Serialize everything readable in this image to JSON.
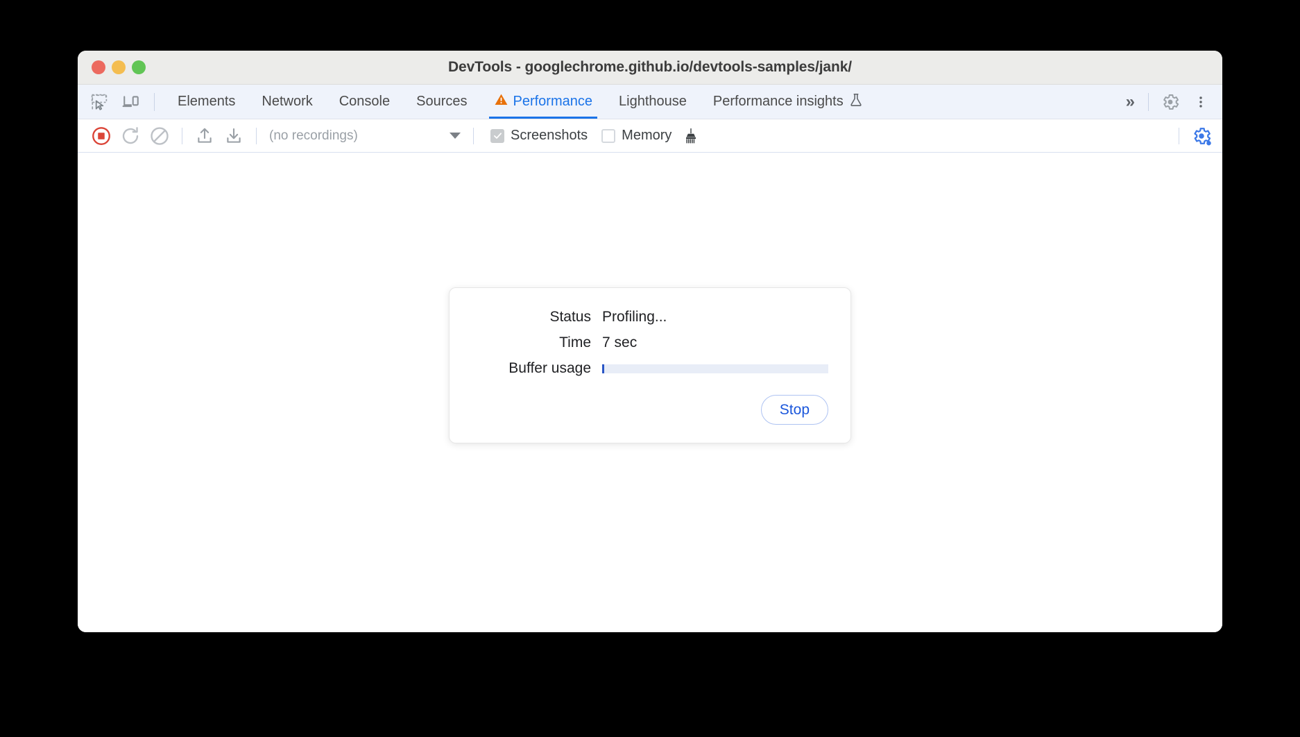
{
  "window": {
    "title": "DevTools - googlechrome.github.io/devtools-samples/jank/",
    "traffic_lights": [
      {
        "name": "close",
        "color": "#ec6a5f"
      },
      {
        "name": "minimize",
        "color": "#f4bd50"
      },
      {
        "name": "zoom",
        "color": "#61c555"
      }
    ]
  },
  "tabbar": {
    "inspect_icon": "inspect-element-icon",
    "device_icon": "device-toolbar-icon",
    "tabs": [
      {
        "label": "Elements",
        "active": false
      },
      {
        "label": "Network",
        "active": false
      },
      {
        "label": "Console",
        "active": false
      },
      {
        "label": "Sources",
        "active": false
      },
      {
        "label": "Performance",
        "active": true,
        "icon": "warning-triangle-icon"
      },
      {
        "label": "Lighthouse",
        "active": false
      },
      {
        "label": "Performance insights",
        "active": false,
        "icon": "experiment-flask-icon"
      }
    ],
    "more_tabs_label": "»",
    "settings_icon": "gear-icon",
    "more_options_icon": "three-dot-menu-icon",
    "accent_color": "#1a73e8",
    "warning_color": "#e8710a"
  },
  "toolbar": {
    "record_icon": "stop-recording-icon",
    "reload_icon": "reload-and-record-icon",
    "clear_icon": "clear-recording-icon",
    "load_icon": "import-profile-icon",
    "save_icon": "export-profile-icon",
    "recordings_value": "(no recordings)",
    "recordings_caret": "chevron-down-icon",
    "screenshots_label": "Screenshots",
    "screenshots_checked": true,
    "memory_label": "Memory",
    "memory_checked": false,
    "gc_icon": "collect-garbage-icon",
    "capture_settings_icon": "capture-settings-gear-icon",
    "record_color": "#db4437",
    "settings_active_color": "#1a73e8"
  },
  "status_dialog": {
    "rows": [
      {
        "label": "Status",
        "value": "Profiling..."
      },
      {
        "label": "Time",
        "value": "7 sec"
      }
    ],
    "buffer_label": "Buffer usage",
    "buffer_percent": 1,
    "stop_label": "Stop"
  }
}
